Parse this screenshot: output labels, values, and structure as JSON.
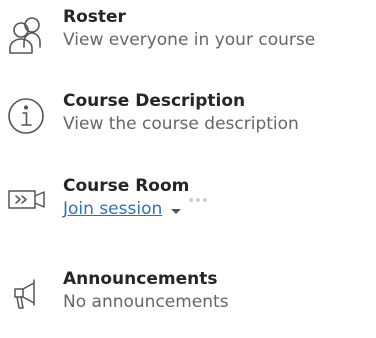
{
  "tools": [
    {
      "title": "Roster",
      "subtitle": "View everyone in your course",
      "icon": "people-icon"
    },
    {
      "title": "Course Description",
      "subtitle": "View the course description",
      "icon": "info-icon"
    },
    {
      "title": "Course Room",
      "link": "Join session",
      "icon": "video-camera-icon"
    },
    {
      "title": "Announcements",
      "subtitle": "No announcements",
      "icon": "megaphone-icon"
    }
  ],
  "colors": {
    "title": "#262626",
    "subtitle": "#666666",
    "link": "#2b72bd",
    "icon": "#555555"
  }
}
